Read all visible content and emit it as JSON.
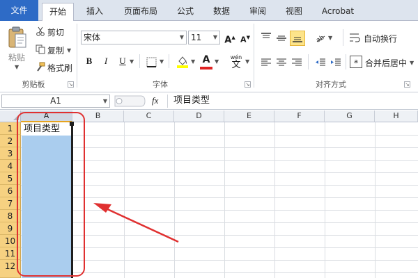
{
  "tabs": [
    {
      "label": "文件"
    },
    {
      "label": "开始"
    },
    {
      "label": "插入"
    },
    {
      "label": "页面布局"
    },
    {
      "label": "公式"
    },
    {
      "label": "数据"
    },
    {
      "label": "审阅"
    },
    {
      "label": "视图"
    },
    {
      "label": "Acrobat"
    }
  ],
  "active_tab": "开始",
  "clipboard": {
    "paste_label": "粘贴",
    "cut_label": "剪切",
    "copy_label": "复制",
    "format_painter_label": "格式刷",
    "group_label": "剪贴板"
  },
  "font": {
    "font_name": "宋体",
    "font_size": "11",
    "group_label": "字体",
    "bold": "B",
    "italic": "I",
    "underline": "U",
    "wen": "wén",
    "wen_char": "文",
    "grow": "A",
    "shrink": "A",
    "font_color_letter": "A"
  },
  "alignment": {
    "wrap_label": "自动换行",
    "merge_label": "合并后居中",
    "group_label": "对齐方式",
    "merge_icon_text": "a"
  },
  "formula_bar": {
    "name_box": "A1",
    "fx": "fx",
    "content": "项目类型"
  },
  "grid": {
    "columns": [
      "A",
      "B",
      "C",
      "D",
      "E",
      "F",
      "G",
      "H"
    ],
    "rows": [
      "1",
      "2",
      "3",
      "4",
      "5",
      "6",
      "7",
      "8",
      "9",
      "10",
      "11",
      "12"
    ],
    "selected_column": "A",
    "cell_A1": "项目类型"
  },
  "colors": {
    "file_tab": "#2e6bc6",
    "selection_fill": "#aacdee",
    "row_header_highlight": "#f6d181",
    "annotation_red": "#e03030",
    "align_active": "#fde48a"
  },
  "icons": [
    "paste-icon",
    "scissors-icon",
    "copy-icon",
    "format-painter-icon",
    "border-icon",
    "fill-color-icon",
    "font-color-icon",
    "align-icon",
    "wrap-icon",
    "merge-icon",
    "fx-icon"
  ]
}
